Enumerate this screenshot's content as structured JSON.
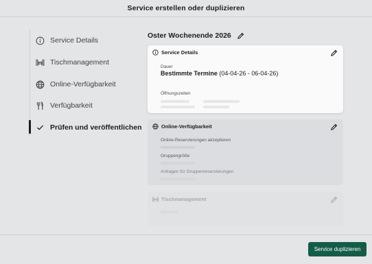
{
  "modal": {
    "title": "Service erstellen oder duplizieren"
  },
  "sidebar": {
    "items": [
      {
        "label": "Service Details",
        "icon": "info-icon"
      },
      {
        "label": "Tischmanagement",
        "icon": "table-icon"
      },
      {
        "label": "Online-Verfügbarkeit",
        "icon": "globe-icon"
      },
      {
        "label": "Verfügbarkeit",
        "icon": "cutlery-icon"
      },
      {
        "label": "Prüfen und veröffentlichen",
        "icon": "check-icon",
        "active": true
      }
    ]
  },
  "main": {
    "service_name": "Oster Wochenende 2026",
    "cards": {
      "details": {
        "title": "Service Details",
        "duration_label": "Dauer",
        "duration_value_bold": "Bestimmte Termine",
        "duration_value_range": "(04-04-26 - 06-04-26)",
        "hours_label": "Öffnungszeiten"
      },
      "online": {
        "title": "Online-Verfügbarkeit",
        "accept_label": "Online-Reservierungen akzeptieren",
        "group_size_label": "Gruppengröße",
        "group_requests_label": "Anfragen für Gruppenreservierungen"
      },
      "tables": {
        "title": "Tischmanagement",
        "area_label": "Bereiche"
      }
    }
  },
  "footer": {
    "primary_button": "Service duplizieren"
  },
  "colors": {
    "primary": "#145c48",
    "background": "#e4e5e7",
    "text": "#1b1d20"
  }
}
